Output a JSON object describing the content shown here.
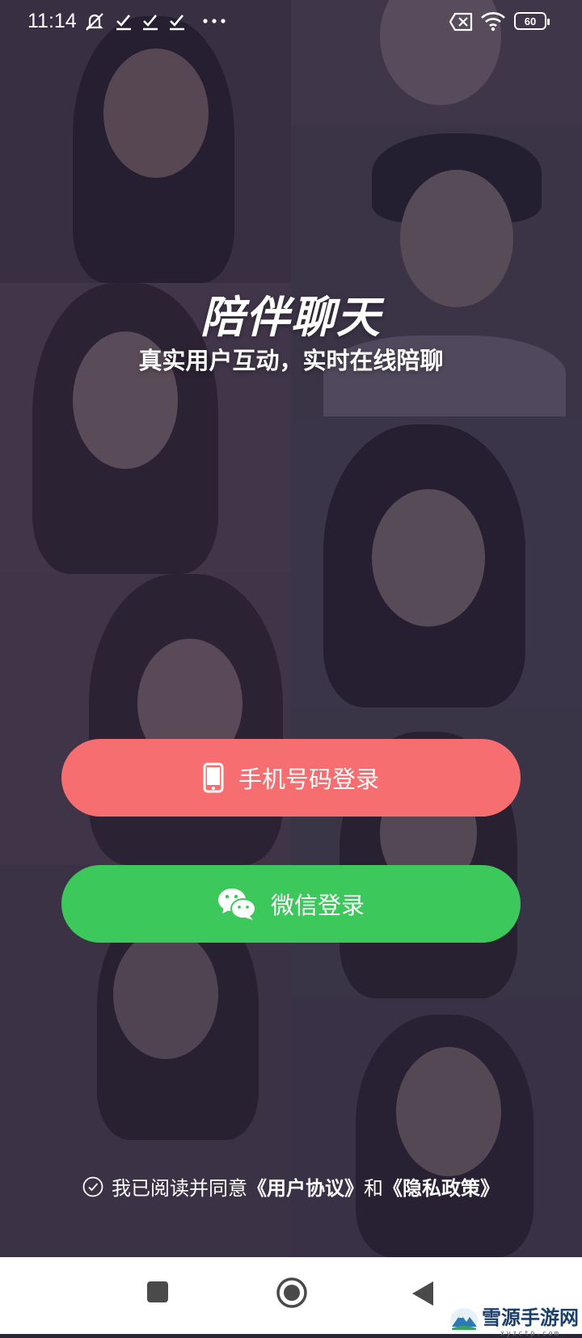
{
  "status_bar": {
    "time": "11:14",
    "battery": "60",
    "icons": [
      "mute-icon",
      "check-icon",
      "check-icon",
      "check-icon",
      "more-dots-icon",
      "sim-off-icon",
      "wifi-icon",
      "battery-icon"
    ]
  },
  "hero": {
    "title": "陪伴聊天",
    "subtitle": "真实用户互动，实时在线陪聊"
  },
  "buttons": {
    "phone_login": "手机号码登录",
    "wechat_login": "微信登录"
  },
  "agreement": {
    "prefix": "我已阅读并同意",
    "user_agreement": "《用户协议》",
    "conjunction": "和",
    "privacy_policy": "《隐私政策》"
  },
  "watermark": {
    "text": "雪源手游网",
    "sub": "xyzctp.com"
  },
  "colors": {
    "phone_button": "#f76e71",
    "wechat_button": "#3dc85c",
    "overlay": "#2c243e"
  }
}
